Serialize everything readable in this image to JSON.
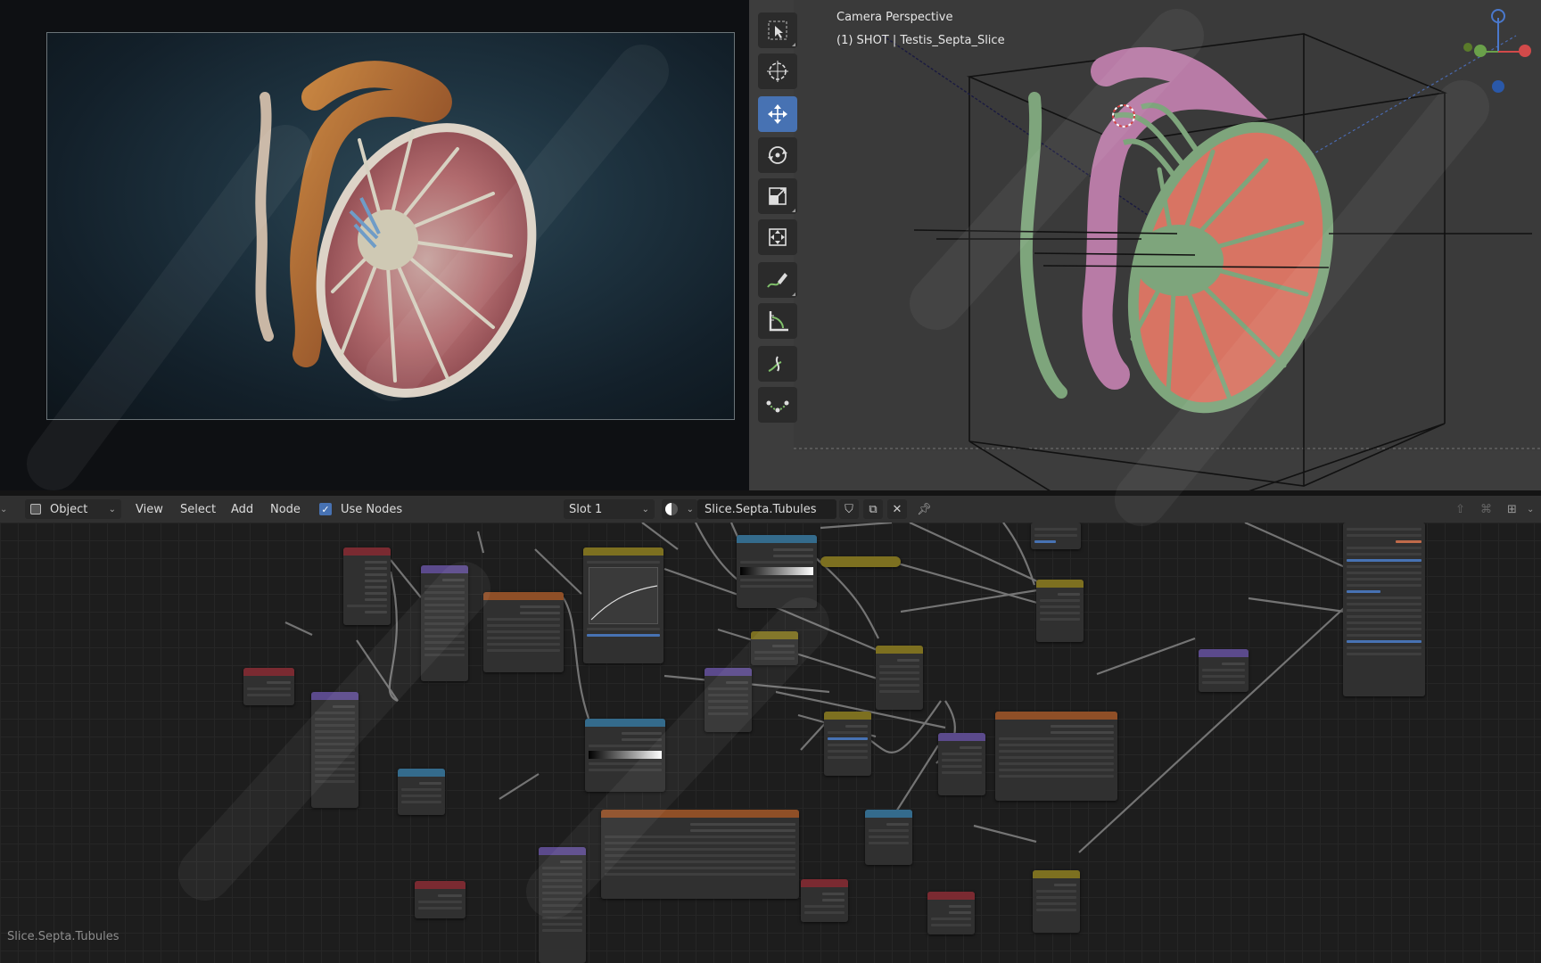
{
  "viewport": {
    "camera_label": "Camera Perspective",
    "shot_label": "(1) SHOT | Testis_Septa_Slice"
  },
  "toolbar": {
    "tools": [
      {
        "name": "select-box",
        "icon": "select-box-icon",
        "active": false
      },
      {
        "name": "cursor",
        "icon": "cursor-icon",
        "active": false
      },
      {
        "name": "move",
        "icon": "move-icon",
        "active": true
      },
      {
        "name": "rotate",
        "icon": "rotate-icon",
        "active": false
      },
      {
        "name": "scale",
        "icon": "scale-icon",
        "active": false
      },
      {
        "name": "transform",
        "icon": "transform-icon",
        "active": false
      },
      {
        "name": "annotate",
        "icon": "annotate-icon",
        "active": false
      },
      {
        "name": "measure",
        "icon": "measure-icon",
        "active": false
      },
      {
        "name": "add-cube",
        "icon": "add-cube-icon",
        "active": false
      },
      {
        "name": "shear",
        "icon": "shear-icon",
        "active": false
      }
    ]
  },
  "node_header": {
    "object_mode": "Object",
    "menu": {
      "view": "View",
      "select": "Select",
      "add": "Add",
      "node": "Node"
    },
    "use_nodes_label": "Use Nodes",
    "use_nodes_checked": true,
    "slot": "Slot 1",
    "material_name": "Slice.Septa.Tubules"
  },
  "status": {
    "material_label": "Slice.Septa.Tubules"
  },
  "colors": {
    "accent": "#4772b3",
    "render_bg": "#1e3340",
    "viewport_bg": "#3d3d3d",
    "node_editor_bg": "#1d1d1d",
    "tissue_red": "#d87463",
    "septa_green": "#7ea57c",
    "epididymis_pink": "#b87ba6"
  }
}
